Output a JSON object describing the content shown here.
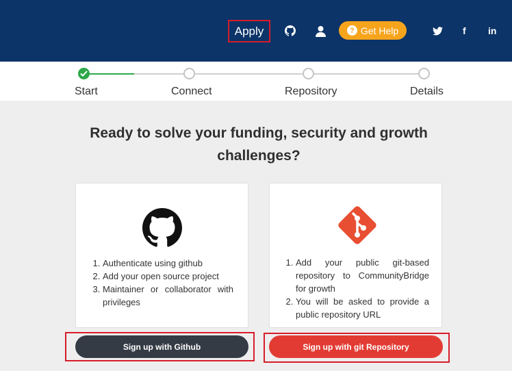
{
  "header": {
    "apply_label": "Apply",
    "icons": [
      "github-icon",
      "user-icon"
    ],
    "get_help_label": "Get Help",
    "social": {
      "twitter": "t",
      "facebook": "f",
      "linkedin": "in"
    }
  },
  "stepper": {
    "steps": [
      {
        "label": "Start",
        "state": "complete"
      },
      {
        "label": "Connect",
        "state": "pending"
      },
      {
        "label": "Repository",
        "state": "pending"
      },
      {
        "label": "Details",
        "state": "pending"
      }
    ]
  },
  "main": {
    "headline_line1": "Ready to solve your funding, security and growth",
    "headline_line2": "challenges?",
    "cards": [
      {
        "icon": "github-icon",
        "items": [
          "Authenticate using github",
          "Add your open source project",
          "Maintainer or collaborator with privileges"
        ],
        "button_label": "Sign up with Github"
      },
      {
        "icon": "git-icon",
        "items": [
          "Add your public git-based repository to CommunityBridge for growth",
          "You will be asked to provide a public repository URL"
        ],
        "button_label": "Sign up with git Repository"
      }
    ]
  },
  "colors": {
    "header_bg": "#0c3468",
    "help_btn": "#f7a41d",
    "step_done": "#2ea84a",
    "github_btn": "#353b45",
    "git_btn": "#e23b33",
    "highlight": "#d81c2a"
  }
}
